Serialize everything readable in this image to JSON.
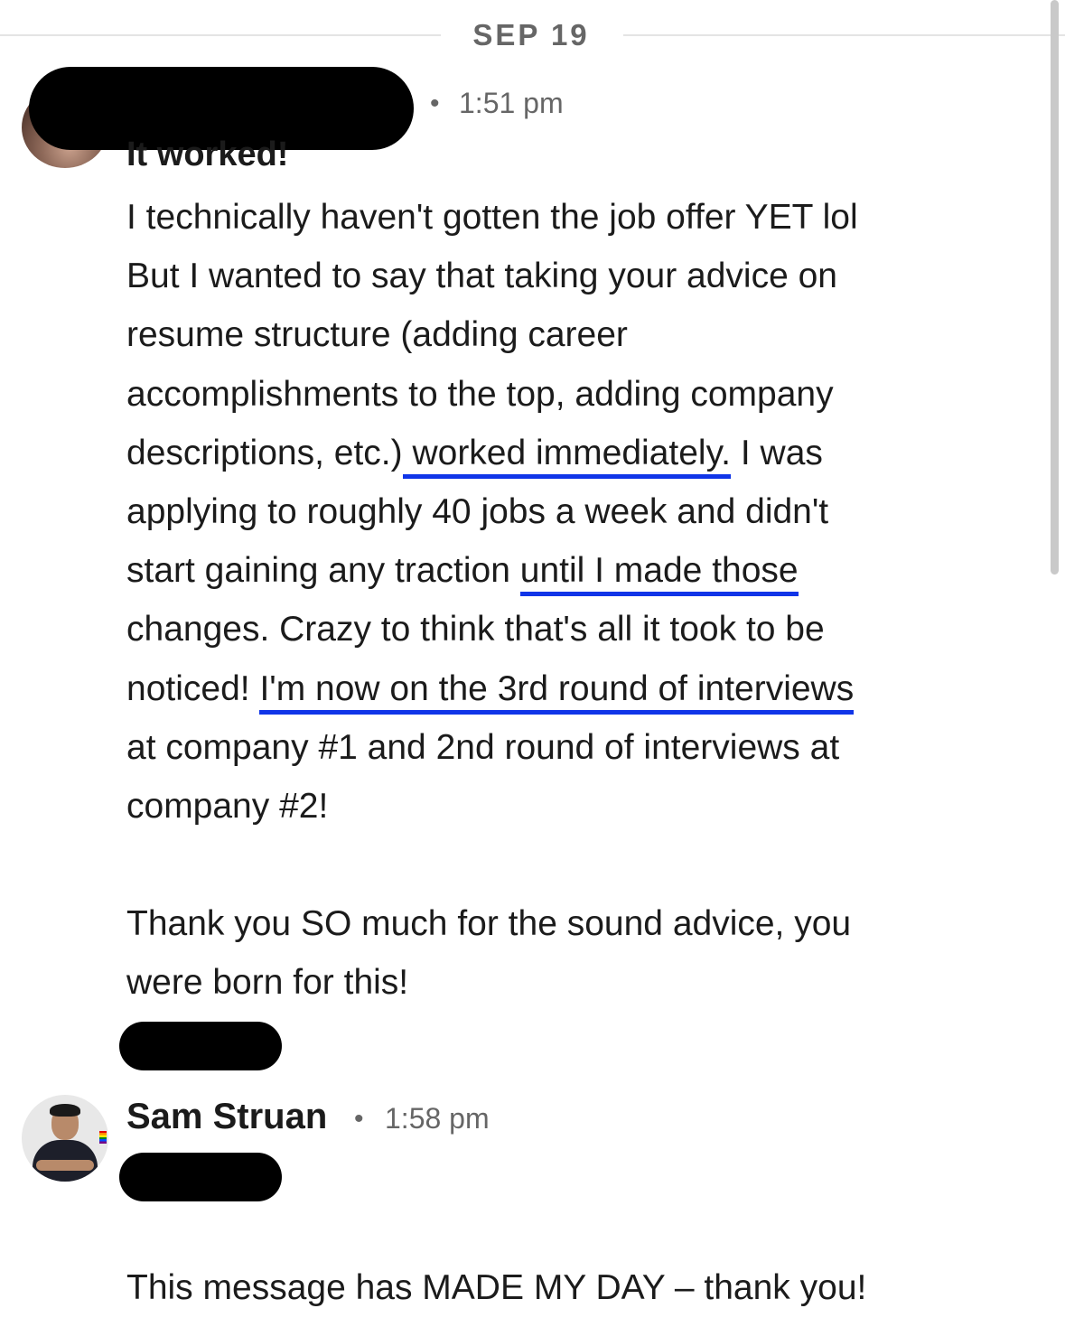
{
  "date_divider": {
    "label": "SEP 19"
  },
  "message_1": {
    "sender": "",
    "separator": "•",
    "time": "1:51 pm",
    "headline": "It worked!",
    "lines": [
      [
        "I technically haven't gotten the job offer YET lol"
      ],
      [
        "But I wanted to say that taking your advice on"
      ],
      [
        "resume structure (adding career"
      ],
      [
        "accomplishments to the top, adding company"
      ],
      [
        "descriptions, etc.)",
        " worked immediately.",
        " I was"
      ],
      [
        "applying to roughly 40 jobs a week and didn't"
      ],
      [
        "start gaining any traction ",
        "until I made those",
        ""
      ],
      [
        "changes. Crazy to think that's all it took to be"
      ],
      [
        "noticed! ",
        "I'm now on the 3rd round of interviews",
        ""
      ],
      [
        "at company #1 and 2nd round of interviews at"
      ],
      [
        "company #2!"
      ],
      [
        ""
      ],
      [
        "Thank you SO much for the sound advice, you"
      ],
      [
        "were born for this!"
      ]
    ],
    "underline_color": "#1035e8"
  },
  "message_2": {
    "sender": "Sam Struan",
    "separator": "•",
    "time": "1:58 pm",
    "text": "This message has MADE MY DAY – thank you!"
  }
}
